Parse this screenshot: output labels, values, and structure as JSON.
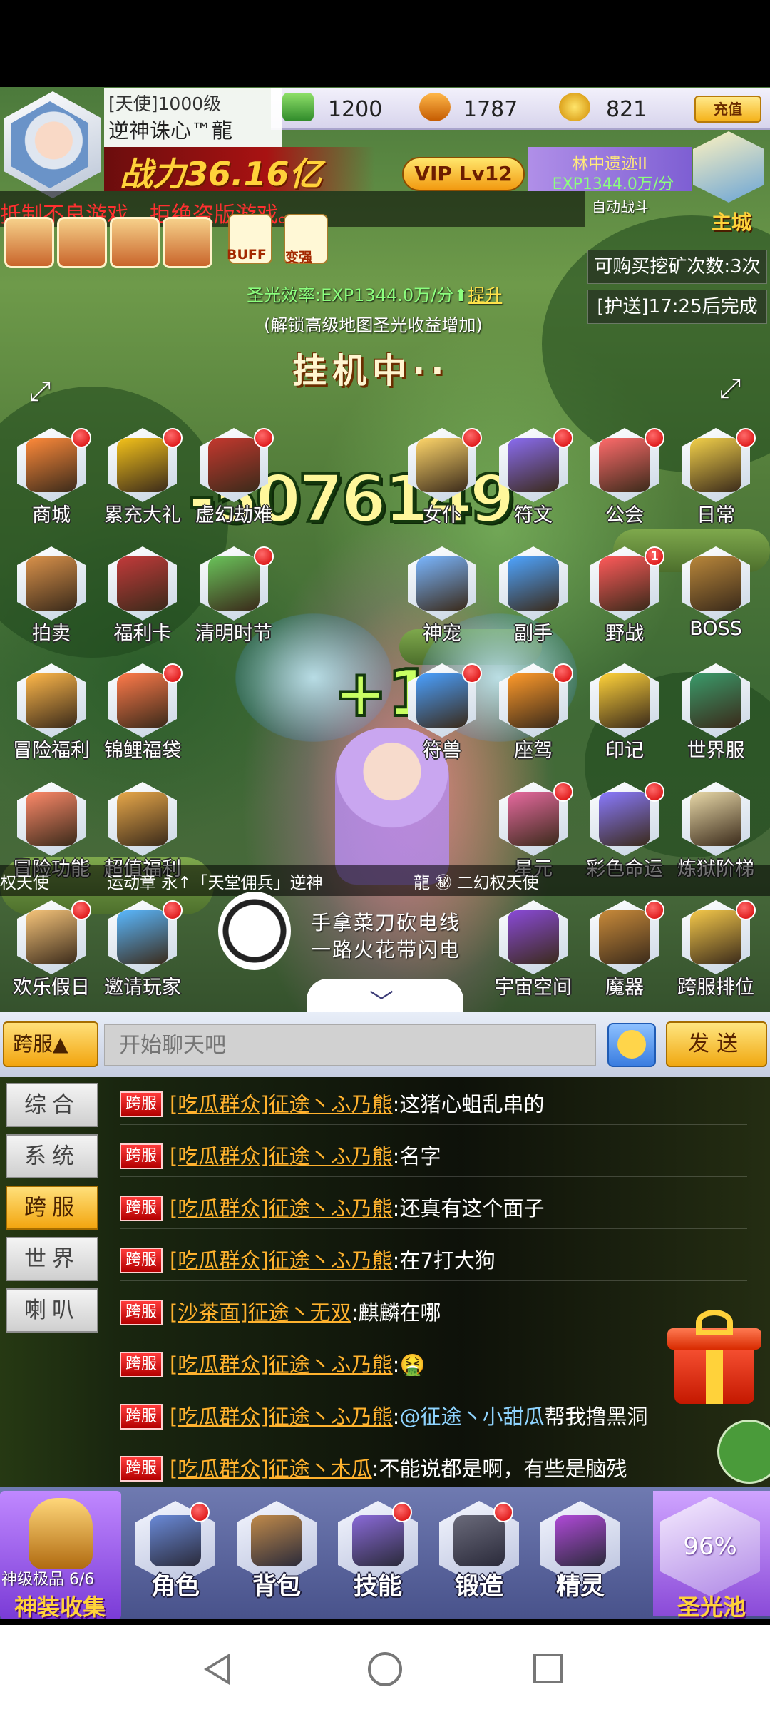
{
  "player": {
    "level": "[天使]1000级",
    "nickname": "逆神诛心™龍",
    "power": "战力36.16亿",
    "vip": "VIP Lv12"
  },
  "currency": {
    "cash": "1200",
    "diamond": "1787",
    "gold": "821",
    "recharge_label": "充值"
  },
  "map": {
    "name": "林中遗迹II",
    "exp": "EXP1344.0万/分",
    "auto_battle": "自动战斗",
    "city_label": "主城"
  },
  "warning": "抵制不良游戏，拒绝盗版游戏。",
  "buffs": {
    "buff_label": "BUFF",
    "stronger_label": "变强"
  },
  "info": {
    "mine_count": "可购买挖矿次数:3次",
    "escort": "[护送]17:25后完成"
  },
  "holy_light": {
    "rate_prefix": "圣光效率:EXP1344.0万/分",
    "boost": "提升",
    "tip": "(解锁高级地图圣光收益增加)",
    "idle": "挂机中··"
  },
  "battle": {
    "damage": "-5076149",
    "plus": "+1"
  },
  "features": [
    {
      "label": "商城",
      "dot": true
    },
    {
      "label": "累充大礼",
      "dot": true
    },
    {
      "label": "虚幻劫难",
      "dot": true
    },
    {
      "label": "女仆",
      "dot": true
    },
    {
      "label": "符文",
      "dot": true
    },
    {
      "label": "公会",
      "dot": true
    },
    {
      "label": "日常",
      "dot": true
    },
    {
      "label": "拍卖",
      "dot": false
    },
    {
      "label": "福利卡",
      "dot": false
    },
    {
      "label": "清明时节",
      "dot": true
    },
    {
      "label": "神宠",
      "dot": false
    },
    {
      "label": "副手",
      "dot": false
    },
    {
      "label": "野战",
      "dot": true,
      "count": "1"
    },
    {
      "label": "BOSS",
      "dot": false
    },
    {
      "label": "冒险福利",
      "dot": false
    },
    {
      "label": "锦鲤福袋",
      "dot": true
    },
    {
      "label": "符兽",
      "dot": true
    },
    {
      "label": "座驾",
      "dot": true
    },
    {
      "label": "印记",
      "dot": false
    },
    {
      "label": "世界服",
      "dot": false
    },
    {
      "label": "冒险功能",
      "dot": false
    },
    {
      "label": "超值福利",
      "dot": false
    },
    {
      "label": "星元",
      "dot": true
    },
    {
      "label": "彩色命运",
      "dot": true
    },
    {
      "label": "炼狱阶梯",
      "dot": false
    },
    {
      "label": "欢乐假日",
      "dot": true
    },
    {
      "label": "邀请玩家",
      "dot": true
    },
    {
      "label": "宇宙空间",
      "dot": false
    },
    {
      "label": "魔器",
      "dot": true
    },
    {
      "label": "跨服排位",
      "dot": true
    }
  ],
  "marquee": {
    "left": "权天使",
    "middle": "运动章 永↑「天堂佣兵」逆神",
    "right": "龍  ㊙ 二幻权天使"
  },
  "slogan": {
    "line1": "手拿菜刀砍电线",
    "line2": "一路火花带闪电"
  },
  "chat": {
    "channel_selector": "跨服▲",
    "input_placeholder": "开始聊天吧",
    "send_label": "发送",
    "tabs": [
      "综合",
      "系统",
      "跨服",
      "世界",
      "喇叭"
    ],
    "active_tab": "跨服",
    "messages": [
      {
        "badge": "跨服",
        "sender": "[吃瓜群众]征途丶ふ乃熊",
        "text": "这猪心蛆乱串的"
      },
      {
        "badge": "跨服",
        "sender": "[吃瓜群众]征途丶ふ乃熊",
        "text": "名字"
      },
      {
        "badge": "跨服",
        "sender": "[吃瓜群众]征途丶ふ乃熊",
        "text": "还真有这个面子"
      },
      {
        "badge": "跨服",
        "sender": "[吃瓜群众]征途丶ふ乃熊",
        "text": "在7打大狗"
      },
      {
        "badge": "跨服",
        "sender": "[沙茶面]征途丶无双",
        "text": "麒麟在哪"
      },
      {
        "badge": "跨服",
        "sender": "[吃瓜群众]征途丶ふ乃熊",
        "text": "🤮"
      },
      {
        "badge": "跨服",
        "sender": "[吃瓜群众]征途丶ふ乃熊",
        "mention": "@征途丶小甜瓜",
        "text": "帮我撸黑洞"
      },
      {
        "badge": "跨服",
        "sender": "[吃瓜群众]征途丶木瓜",
        "text": "不能说都是啊，有些是脑残"
      }
    ]
  },
  "bottom_menu": {
    "god_gear_sub": "神级极品 6/6",
    "god_gear_title": "神装收集",
    "items": [
      {
        "label": "角色",
        "dot": true
      },
      {
        "label": "背包",
        "dot": false
      },
      {
        "label": "技能",
        "dot": true
      },
      {
        "label": "锻造",
        "dot": true
      },
      {
        "label": "精灵",
        "dot": false
      }
    ],
    "holy_pool_pct": "96%",
    "holy_pool_title": "圣光池"
  },
  "colors": {
    "accent_gold": "#ffd23a",
    "notify_red": "#d40000",
    "chat_sender": "#ffb22e"
  }
}
